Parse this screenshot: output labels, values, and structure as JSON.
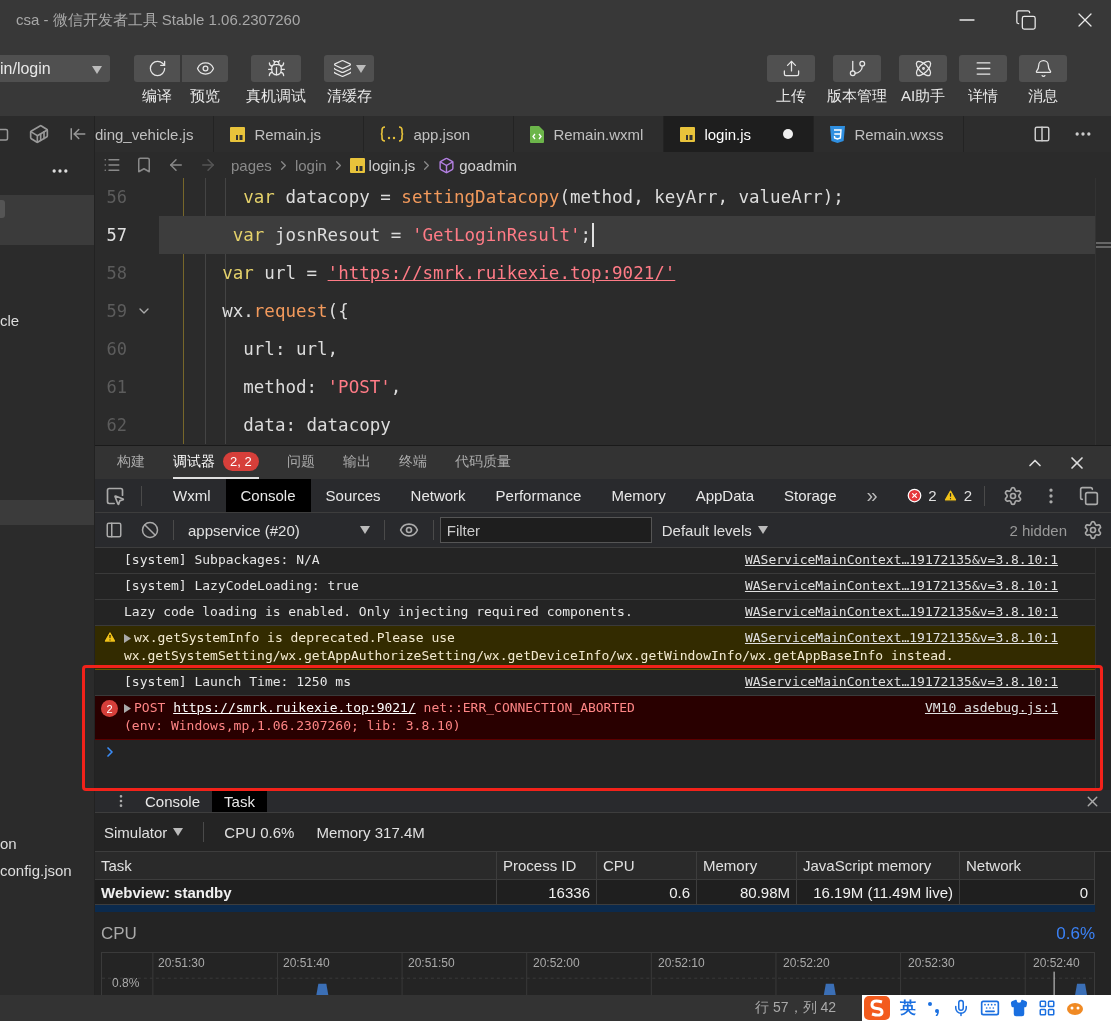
{
  "window": {
    "title": "csa - 微信开发者工具 Stable 1.06.2307260"
  },
  "toolbar": {
    "path_select": "in/login",
    "left_buttons": [
      {
        "label": "编译"
      },
      {
        "label": "预览"
      },
      {
        "label": "真机调试"
      },
      {
        "label": "清缓存",
        "dropdown": true
      }
    ],
    "right_buttons": [
      {
        "label": "上传"
      },
      {
        "label": "版本管理"
      },
      {
        "label": "AI助手"
      },
      {
        "label": "详情"
      },
      {
        "label": "消息"
      }
    ]
  },
  "sidebar": {
    "items": [
      {
        "kind": "band",
        "selected": true
      },
      {
        "kind": "file",
        "label": "cle",
        "selected": false
      },
      {
        "kind": "band",
        "selected": true
      },
      {
        "kind": "file",
        "label": "on",
        "selected": false
      },
      {
        "kind": "file",
        "label": "config.json",
        "selected": false
      }
    ]
  },
  "editor_tabs": [
    {
      "label": "ding_vehicle.js",
      "kind": "plain",
      "selected": false,
      "modified": false
    },
    {
      "label": "Remain.js",
      "kind": "js",
      "selected": false,
      "modified": false
    },
    {
      "label": "app.json",
      "kind": "json",
      "selected": false,
      "modified": false
    },
    {
      "label": "Remain.wxml",
      "kind": "wxml",
      "selected": false,
      "modified": false
    },
    {
      "label": "login.js",
      "kind": "js",
      "selected": true,
      "modified": true
    },
    {
      "label": "Remain.wxss",
      "kind": "wxss",
      "selected": false,
      "modified": false
    }
  ],
  "breadcrumb": [
    {
      "label": "pages",
      "kind": "folder"
    },
    {
      "label": "login",
      "kind": "folder"
    },
    {
      "label": "login.js",
      "kind": "js"
    },
    {
      "label": "goadmin",
      "kind": "symbol"
    }
  ],
  "code_lines": [
    {
      "number": "56",
      "current": false,
      "foldable": false,
      "tokens": [
        {
          "kind": "kw",
          "text": "        var"
        },
        {
          "kind": "plain",
          "text": " datacopy = "
        },
        {
          "kind": "fn",
          "text": "settingDatacopy"
        },
        {
          "kind": "plain",
          "text": "(method, keyArr, valueArr);"
        }
      ]
    },
    {
      "number": "57",
      "current": true,
      "foldable": false,
      "tokens": [
        {
          "kind": "kw",
          "text": "       var"
        },
        {
          "kind": "plain",
          "text": " josnResout = "
        },
        {
          "kind": "str",
          "text": "'GetLoginResult'"
        },
        {
          "kind": "plain",
          "text": ";"
        }
      ]
    },
    {
      "number": "58",
      "current": false,
      "foldable": false,
      "tokens": [
        {
          "kind": "kw",
          "text": "      var"
        },
        {
          "kind": "plain",
          "text": " url = "
        },
        {
          "kind": "link",
          "text": "'https://smrk.ruikexie.top:9021/'"
        }
      ]
    },
    {
      "number": "59",
      "current": false,
      "foldable": true,
      "tokens": [
        {
          "kind": "plain",
          "text": "      wx."
        },
        {
          "kind": "fn",
          "text": "request"
        },
        {
          "kind": "plain",
          "text": "({"
        }
      ]
    },
    {
      "number": "60",
      "current": false,
      "foldable": false,
      "tokens": [
        {
          "kind": "plain",
          "text": "        url: url,"
        }
      ]
    },
    {
      "number": "61",
      "current": false,
      "foldable": false,
      "tokens": [
        {
          "kind": "plain",
          "text": "        method: "
        },
        {
          "kind": "str",
          "text": "'POST'"
        },
        {
          "kind": "plain",
          "text": ","
        }
      ]
    },
    {
      "number": "62",
      "current": false,
      "foldable": false,
      "tokens": [
        {
          "kind": "plain",
          "text": "        data: datacopy"
        }
      ]
    }
  ],
  "panel_tabs": [
    {
      "label": "构建",
      "selected": false
    },
    {
      "label": "调试器",
      "selected": true,
      "badge": "2, 2"
    },
    {
      "label": "问题",
      "selected": false
    },
    {
      "label": "输出",
      "selected": false
    },
    {
      "label": "终端",
      "selected": false
    },
    {
      "label": "代码质量",
      "selected": false
    }
  ],
  "devtools_tabs": [
    {
      "label": "Wxml",
      "selected": false
    },
    {
      "label": "Console",
      "selected": true
    },
    {
      "label": "Sources",
      "selected": false
    },
    {
      "label": "Network",
      "selected": false
    },
    {
      "label": "Performance",
      "selected": false
    },
    {
      "label": "Memory",
      "selected": false
    },
    {
      "label": "AppData",
      "selected": false
    },
    {
      "label": "Storage",
      "selected": false
    }
  ],
  "more_tabs": "»",
  "error_count": "2",
  "warning_count": "2",
  "console_toolbar": {
    "context": "appservice (#20)",
    "filter": {
      "placeholder": "Filter"
    },
    "levels": "Default levels",
    "hidden": "2 hidden"
  },
  "console_messages": [
    {
      "kind": "info",
      "text": "[system] Subpackages: N/A",
      "source": "WAServiceMainContext…19172135&v=3.8.10:1"
    },
    {
      "kind": "info",
      "text": "[system] LazyCodeLoading: true",
      "source": "WAServiceMainContext…19172135&v=3.8.10:1"
    },
    {
      "kind": "info",
      "text": "Lazy code loading is enabled. Only injecting required components.",
      "source": "WAServiceMainContext…19172135&v=3.8.10:1"
    },
    {
      "kind": "warning",
      "expandable": true,
      "text": "wx.getSystemInfo is deprecated.Please use",
      "text_continued": "wx.getSystemSetting/wx.getAppAuthorizeSetting/wx.getDeviceInfo/wx.getWindowInfo/wx.getAppBaseInfo instead.",
      "source": "WAServiceMainContext…19172135&v=3.8.10:1"
    },
    {
      "kind": "info",
      "text": "[system] Launch Time: 1250 ms",
      "source": "WAServiceMainContext…19172135&v=3.8.10:1"
    },
    {
      "kind": "error",
      "expandable": true,
      "count": "2",
      "method": "POST",
      "url": "https://smrk.ruikexie.top:9021/",
      "text": "net::ERR_CONNECTION_ABORTED",
      "detail": "(env: Windows,mp,1.06.2307260; lib: 3.8.10)",
      "source": "VM10 asdebug.js:1"
    },
    {
      "kind": "prompt"
    }
  ],
  "drawer": {
    "tabs": [
      {
        "label": "Console",
        "selected": false
      },
      {
        "label": "Task",
        "selected": true
      }
    ],
    "target": "Simulator",
    "cpu": "CPU 0.6%",
    "memory": "Memory 317.4M",
    "table": {
      "columns": [
        "Task",
        "Process ID",
        "CPU",
        "Memory",
        "JavaScript memory",
        "Network"
      ],
      "rows": [
        {
          "cells": [
            "Webview: standby",
            "16336",
            "0.6",
            "80.98M",
            "16.19M (11.49M live)",
            "0"
          ]
        }
      ]
    },
    "cpu_graph": {
      "title": "CPU",
      "value": "0.6%",
      "y_label": "0.8%",
      "time_labels": [
        "20:51:30",
        "20:51:40",
        "20:51:50",
        "20:52:00",
        "20:52:10",
        "20:52:20",
        "20:52:30",
        "20:52:40"
      ]
    }
  },
  "status_bar": {
    "position": "行 57，列 42"
  },
  "ime_bar": {
    "language": "英"
  }
}
